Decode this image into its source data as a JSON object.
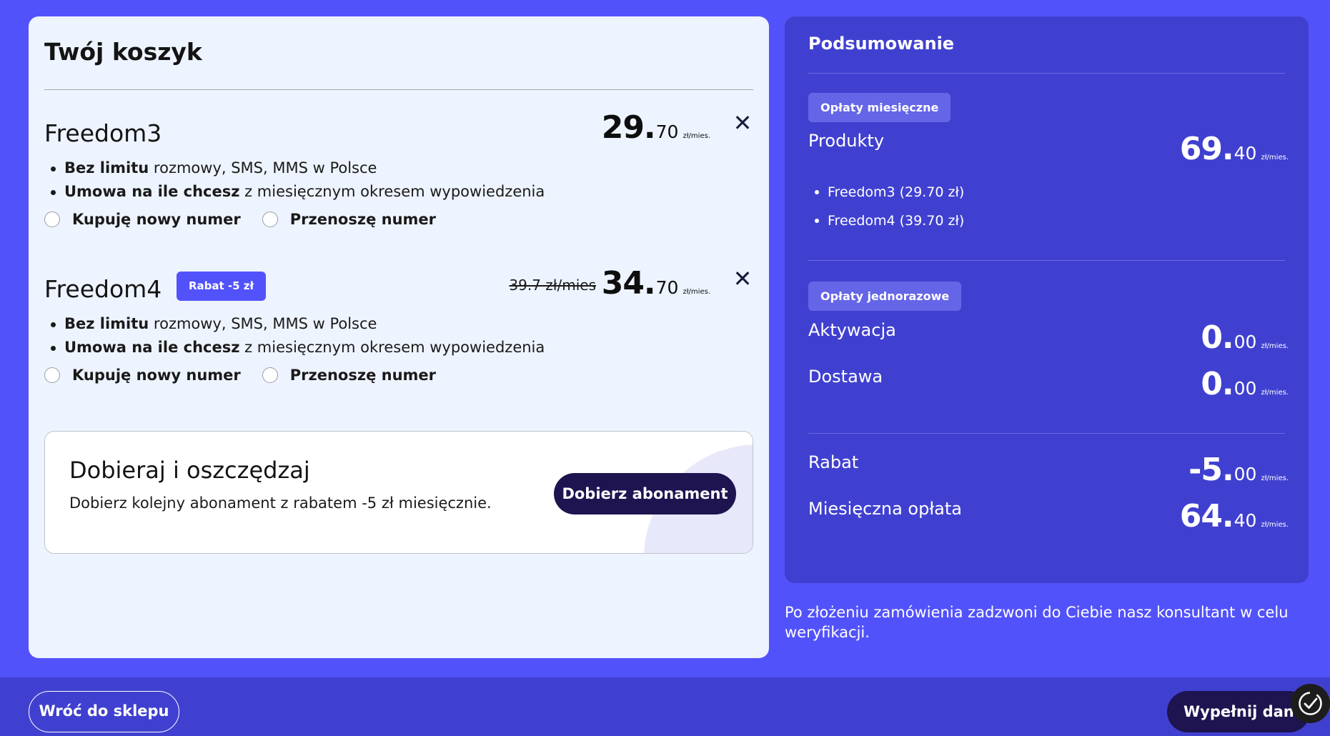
{
  "cart": {
    "title": "Twój koszyk",
    "products": [
      {
        "name": "Freedom3",
        "badge": "",
        "old_price": "",
        "price_main": "29.",
        "price_dec": "70",
        "price_unit": "zł/mies.",
        "features": [
          {
            "bold": "Bez limitu",
            "rest": " rozmowy, SMS, MMS w Polsce"
          },
          {
            "bold": "Umowa na ile chcesz",
            "rest": " z miesięcznym okresem wypowiedzenia"
          }
        ],
        "option_new": "Kupuję nowy numer",
        "option_port": "Przenoszę numer"
      },
      {
        "name": "Freedom4",
        "badge": "Rabat -5 zł",
        "old_price": "39.7 zł/mies",
        "price_main": "34.",
        "price_dec": "70",
        "price_unit": "zł/mies.",
        "features": [
          {
            "bold": "Bez limitu",
            "rest": " rozmowy, SMS, MMS w Polsce"
          },
          {
            "bold": "Umowa na ile chcesz",
            "rest": " z miesięcznym okresem wypowiedzenia"
          }
        ],
        "option_new": "Kupuję nowy numer",
        "option_port": "Przenoszę numer"
      }
    ],
    "promo": {
      "title": "Dobieraj i oszczędzaj",
      "text": "Dobierz kolejny abonament z rabatem -5 zł miesięcznie.",
      "button": "Dobierz abonament"
    }
  },
  "summary": {
    "title": "Podsumowanie",
    "monthly_tag": "Opłaty miesięczne",
    "products_label": "Produkty",
    "products_price_main": "69.",
    "products_price_dec": "40",
    "items": [
      "Freedom3 (29.70 zł)",
      "Freedom4 (39.70 zł)"
    ],
    "onetime_tag": "Opłaty jednorazowe",
    "activation_label": "Aktywacja",
    "activation_main": "0.",
    "activation_dec": "00",
    "delivery_label": "Dostawa",
    "delivery_main": "0.",
    "delivery_dec": "00",
    "discount_label": "Rabat",
    "discount_main": "-5.",
    "discount_dec": "00",
    "monthly_label": "Miesięczna opłata",
    "monthly_main": "64.",
    "monthly_dec": "40",
    "unit": "zł/mies."
  },
  "note": "Po złożeniu zamówienia zadzwoni do Ciebie nasz konsultant w celu weryfikacji.",
  "footer": {
    "back": "Wróć do sklepu",
    "next": "Wypełnij dane"
  },
  "icons": {
    "remove": "close-icon",
    "cookie": "cookie-consent-icon"
  }
}
